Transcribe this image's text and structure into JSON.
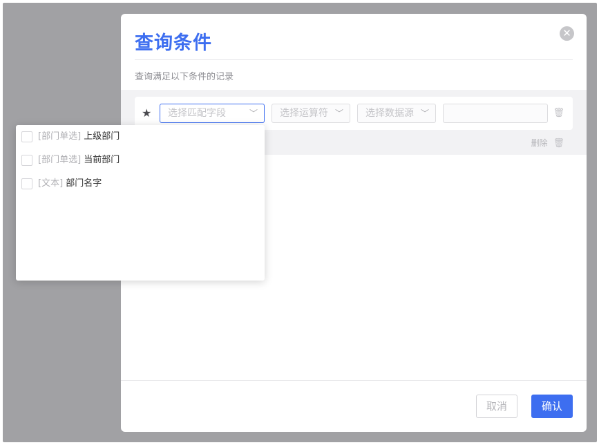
{
  "modal": {
    "title": "查询条件",
    "subtitle": "查询满足以下条件的记录",
    "close_icon": "close-icon"
  },
  "condition_row": {
    "star_icon": "star-icon",
    "field_select_placeholder": "选择匹配字段",
    "operator_select_placeholder": "选择运算符",
    "datasource_select_placeholder": "选择数据源",
    "value_input": "",
    "row_delete_icon": "trash-icon"
  },
  "group": {
    "delete_label": "删除",
    "delete_icon": "trash-icon"
  },
  "footer": {
    "cancel_label": "取消",
    "confirm_label": "确认"
  },
  "field_dropdown": {
    "items": [
      {
        "type": "[部门单选]",
        "name": "上级部门",
        "checked": false
      },
      {
        "type": "[部门单选]",
        "name": "当前部门",
        "checked": false
      },
      {
        "type": "[文本]",
        "name": "部门名字",
        "checked": false
      }
    ]
  },
  "colors": {
    "accent": "#3d6ef0",
    "overlay": "#a1a1a4"
  }
}
